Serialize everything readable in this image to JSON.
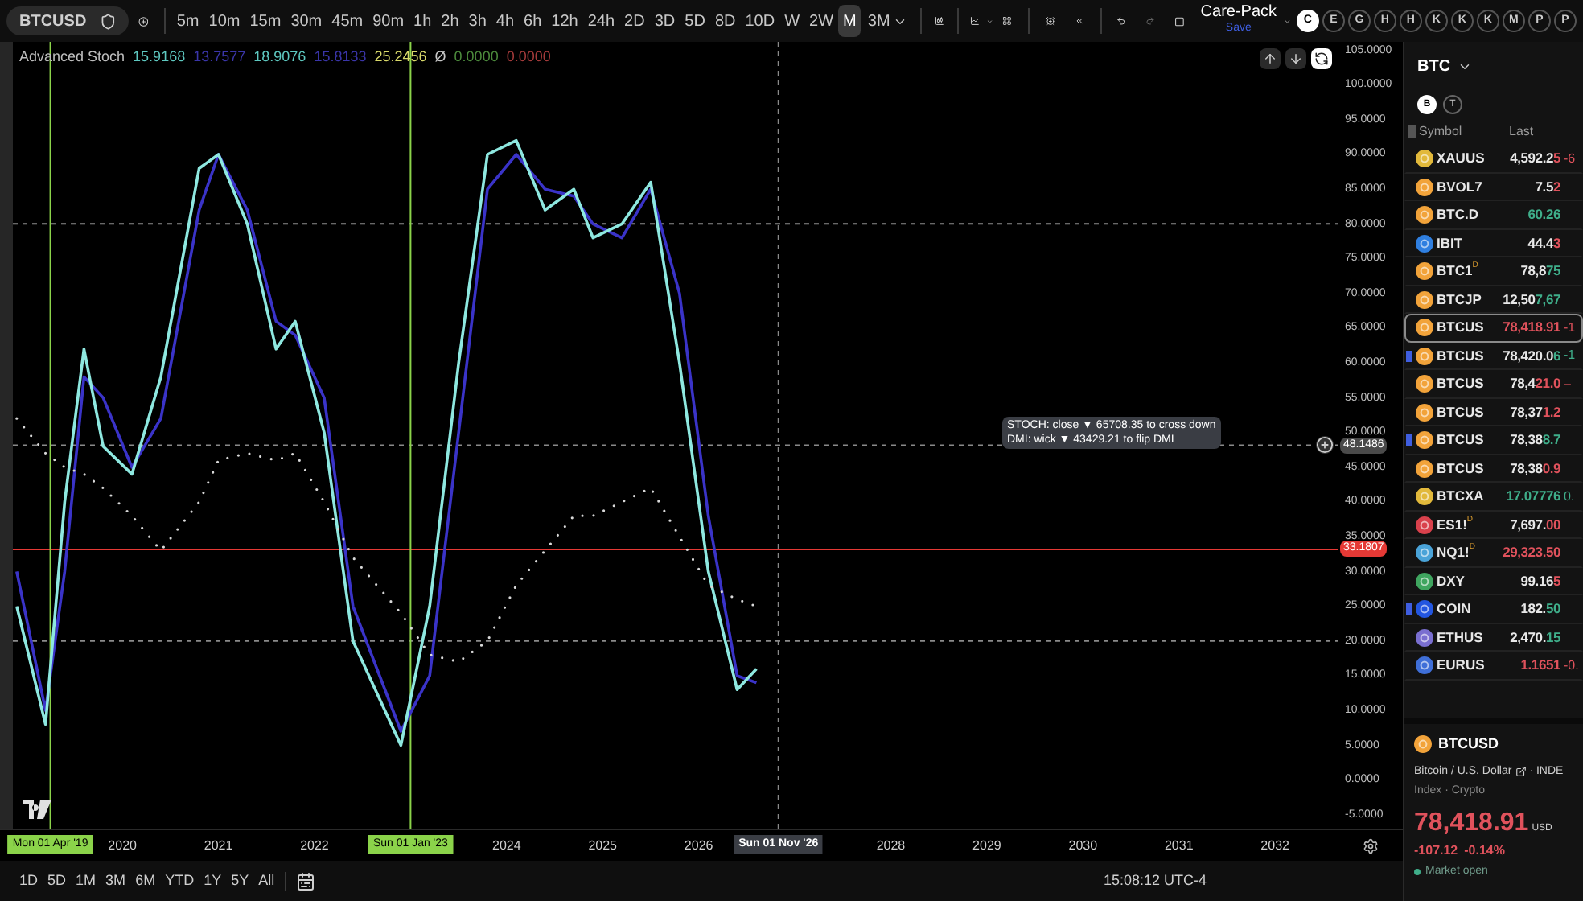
{
  "toolbar": {
    "symbol": "BTCUSD",
    "timeframes": [
      {
        "label": "5m",
        "selected": false
      },
      {
        "label": "10m",
        "selected": false
      },
      {
        "label": "15m",
        "selected": false
      },
      {
        "label": "30m",
        "selected": false
      },
      {
        "label": "45m",
        "selected": false
      },
      {
        "label": "90m",
        "selected": false
      },
      {
        "label": "1h",
        "selected": false
      },
      {
        "label": "2h",
        "selected": false
      },
      {
        "label": "3h",
        "selected": false
      },
      {
        "label": "4h",
        "selected": false
      },
      {
        "label": "6h",
        "selected": false
      },
      {
        "label": "12h",
        "selected": false
      },
      {
        "label": "24h",
        "selected": false
      },
      {
        "label": "2D",
        "selected": false
      },
      {
        "label": "3D",
        "selected": false
      },
      {
        "label": "5D",
        "selected": false
      },
      {
        "label": "8D",
        "selected": false
      },
      {
        "label": "10D",
        "selected": false
      },
      {
        "label": "W",
        "selected": false
      },
      {
        "label": "2W",
        "selected": false
      },
      {
        "label": "M",
        "selected": true
      }
    ],
    "timeframe_menu": "3M",
    "layout": {
      "name": "Care-Pack",
      "status": "Save"
    },
    "quick_buttons": [
      {
        "label": "C",
        "selected": true
      },
      {
        "label": "E",
        "selected": false
      },
      {
        "label": "G",
        "selected": false
      },
      {
        "label": "H",
        "selected": false
      },
      {
        "label": "H",
        "selected": false
      },
      {
        "label": "K",
        "selected": false
      },
      {
        "label": "K",
        "selected": false
      },
      {
        "label": "K",
        "selected": false
      },
      {
        "label": "M",
        "selected": false
      },
      {
        "label": "P",
        "selected": false
      },
      {
        "label": "P",
        "selected": false
      }
    ]
  },
  "legend": {
    "name": "Advanced Stoch",
    "values": [
      {
        "text": "15.9168",
        "color": "#5ec8c0"
      },
      {
        "text": "13.7577",
        "color": "#3a35a8"
      },
      {
        "text": "18.9076",
        "color": "#5ec8c0"
      },
      {
        "text": "15.8133",
        "color": "#3a35a8"
      },
      {
        "text": "25.2456",
        "color": "#d9d96a"
      },
      {
        "text": "Ø",
        "color": "#c8c8c8"
      },
      {
        "text": "0.0000",
        "color": "#4c8a3c"
      },
      {
        "text": "0.0000",
        "color": "#a33a3a"
      }
    ]
  },
  "tooltip": [
    "STOCH: close ▼ 65708.35 to cross down",
    "DMI: wick ▼ 43429.21 to flip DMI"
  ],
  "chart_data": {
    "type": "line",
    "xlim": [
      2018.86,
      2033.33
    ],
    "ylim": [
      -17.41,
      106.2
    ],
    "x": [
      2018.9,
      2019.2,
      2019.4,
      2019.6,
      2019.8,
      2020.1,
      2020.4,
      2020.8,
      2021.0,
      2021.3,
      2021.6,
      2021.8,
      2022.1,
      2022.4,
      2022.9,
      2023.2,
      2023.5,
      2023.8,
      2024.1,
      2024.4,
      2024.7,
      2024.9,
      2025.2,
      2025.5,
      2025.8,
      2026.1,
      2026.4,
      2026.6
    ],
    "series": [
      {
        "color": "#3a33c8",
        "line_style": "solid",
        "values": [
          30,
          10,
          30,
          58,
          55,
          45,
          52,
          82,
          90,
          82,
          66,
          64,
          55,
          25,
          7,
          15,
          50,
          85,
          90,
          85,
          84,
          80,
          78,
          85,
          70,
          38,
          15,
          14
        ]
      },
      {
        "color": "#8ee8e0",
        "line_style": "solid",
        "values": [
          25,
          8,
          40,
          62,
          48,
          44,
          58,
          88,
          90,
          80,
          62,
          66,
          50,
          20,
          5,
          25,
          60,
          90,
          92,
          82,
          85,
          78,
          80,
          86,
          60,
          30,
          13,
          16
        ]
      },
      {
        "color": "#d8d8d8",
        "line_style": "dotted",
        "values": [
          52,
          47,
          45,
          44,
          42,
          38,
          33,
          40,
          46,
          47,
          46,
          47,
          40,
          32,
          24,
          18,
          17,
          20,
          28,
          33,
          38,
          38,
          40,
          42,
          35,
          28,
          26,
          25
        ]
      }
    ],
    "xticks": [
      2020,
      2021,
      2022,
      2024,
      2025,
      2026,
      2028,
      2029,
      2030,
      2031,
      2032
    ],
    "yticks": [
      {
        "value": 105,
        "label": "105.0000"
      },
      {
        "value": 100,
        "label": "100.0000"
      },
      {
        "value": 95,
        "label": "95.0000"
      },
      {
        "value": 90,
        "label": "90.0000"
      },
      {
        "value": 85,
        "label": "85.0000"
      },
      {
        "value": 80,
        "label": "80.0000"
      },
      {
        "value": 75,
        "label": "75.0000"
      },
      {
        "value": 70,
        "label": "70.0000"
      },
      {
        "value": 65,
        "label": "65.0000"
      },
      {
        "value": 60,
        "label": "60.0000"
      },
      {
        "value": 55,
        "label": "55.0000"
      },
      {
        "value": 50,
        "label": "50.0000"
      },
      {
        "value": 45,
        "label": "45.0000"
      },
      {
        "value": 40,
        "label": "40.0000"
      },
      {
        "value": 35,
        "label": "35.0000"
      },
      {
        "value": 30,
        "label": "30.0000"
      },
      {
        "value": 25,
        "label": "25.0000"
      },
      {
        "value": 20,
        "label": "20.0000"
      },
      {
        "value": 15,
        "label": "15.0000"
      },
      {
        "value": 10,
        "label": "10.0000"
      },
      {
        "value": 5,
        "label": "5.0000"
      },
      {
        "value": 0,
        "label": "0.0000"
      },
      {
        "value": -5,
        "label": "-5.0000"
      }
    ],
    "ref_lines": [
      {
        "axis": "y",
        "value": 80,
        "line_style": "dashed"
      },
      {
        "axis": "y",
        "value": 20,
        "line_style": "dashed"
      },
      {
        "axis": "y",
        "value": 48.1486,
        "line_style": "dashed",
        "label": "48.1486"
      },
      {
        "axis": "y",
        "value": 33.1807,
        "line_style": "solid",
        "color": "#e53935",
        "label": "33.1807"
      },
      {
        "axis": "x",
        "value": 2019.25,
        "line_style": "solid",
        "color": "#8bd34a",
        "label": "Mon 01 Apr '19"
      },
      {
        "axis": "x",
        "value": 2023.0,
        "line_style": "solid",
        "color": "#8bd34a",
        "label": "Sun 01 Jan '23"
      },
      {
        "axis": "x",
        "value": 2026.83,
        "line_style": "dashed",
        "label": "Sun 01 Nov '26"
      }
    ]
  },
  "ranges": [
    {
      "label": "1D"
    },
    {
      "label": "5D"
    },
    {
      "label": "1M"
    },
    {
      "label": "3M"
    },
    {
      "label": "6M"
    },
    {
      "label": "YTD"
    },
    {
      "label": "1Y"
    },
    {
      "label": "5Y"
    },
    {
      "label": "All"
    }
  ],
  "clock": "15:08:12 UTC-4",
  "watchlist": {
    "title": "BTC",
    "tabs": [
      {
        "label": "B",
        "selected": true
      },
      {
        "label": "T",
        "selected": false
      }
    ],
    "columns": [
      "Symbol",
      "Last"
    ],
    "rows": [
      {
        "kind": "gold",
        "symbol": "XAUUS",
        "price": "4,592.2",
        "price_move": "5",
        "color": "#e0525c",
        "change": "-6",
        "flagged": false,
        "selected": false
      },
      {
        "kind": "crypto",
        "symbol": "BVOL7",
        "price": "7.5",
        "price_move": "2",
        "color": "#e0525c",
        "flagged": false,
        "selected": false
      },
      {
        "kind": "crypto",
        "symbol": "BTC.D",
        "price_move": "60.26",
        "color": "#3fae8a",
        "flagged": false,
        "selected": false
      },
      {
        "kind": "fund",
        "symbol": "IBIT",
        "price": "44.4",
        "price_move": "3",
        "color": "#e0525c",
        "flagged": false,
        "selected": false
      },
      {
        "kind": "crypto",
        "symbol": "BTC1",
        "badge": "D",
        "price": "78,8",
        "price_move": "75",
        "color": "#3fae8a",
        "flagged": false,
        "selected": false
      },
      {
        "kind": "crypto",
        "symbol": "BTCJP",
        "price": "12,50",
        "price_move": "7,67",
        "color": "#3fae8a",
        "flagged": false,
        "selected": false
      },
      {
        "kind": "crypto",
        "symbol": "BTCUS",
        "price_move": "78,418.91",
        "color": "#e0525c",
        "change": "-1",
        "flagged": false,
        "selected": true
      },
      {
        "kind": "crypto",
        "symbol": "BTCUS",
        "price": "78,420.0",
        "price_move": "6",
        "color": "#3fae8a",
        "change": "-1",
        "flagged": true,
        "selected": false
      },
      {
        "kind": "crypto",
        "symbol": "BTCUS",
        "price": "78,4",
        "price_move": "21.0",
        "color": "#e0525c",
        "change": "–",
        "flagged": false,
        "selected": false
      },
      {
        "kind": "crypto",
        "symbol": "BTCUS",
        "price": "78,37",
        "price_move": "1.2",
        "color": "#e0525c",
        "flagged": false,
        "selected": false
      },
      {
        "kind": "crypto",
        "symbol": "BTCUS",
        "price": "78,38",
        "price_move": "8.7",
        "color": "#3fae8a",
        "flagged": true,
        "selected": false
      },
      {
        "kind": "crypto",
        "symbol": "BTCUS",
        "price": "78,38",
        "price_move": "0.9",
        "color": "#e0525c",
        "flagged": false,
        "selected": false
      },
      {
        "kind": "gold",
        "symbol": "BTCXA",
        "price_move": "17.07776",
        "color": "#3fae8a",
        "change": "0.",
        "flagged": false,
        "selected": false
      },
      {
        "kind": "futures-es",
        "symbol": "ES1!",
        "badge": "D",
        "price": "7,697.",
        "price_move": "00",
        "color": "#e0525c",
        "flagged": false,
        "selected": false
      },
      {
        "kind": "futures-nq",
        "symbol": "NQ1!",
        "badge": "D",
        "price_move": "29,323.50",
        "color": "#e0525c",
        "flagged": false,
        "selected": false
      },
      {
        "kind": "dollar",
        "symbol": "DXY",
        "price": "99.16",
        "price_move": "5",
        "color": "#e0525c",
        "flagged": false,
        "selected": false
      },
      {
        "kind": "stock",
        "symbol": "COIN",
        "price": "182.",
        "price_move": "50",
        "color": "#3fae8a",
        "flagged": true,
        "selected": false
      },
      {
        "kind": "eth",
        "symbol": "ETHUS",
        "price": "2,470.",
        "price_move": "15",
        "color": "#3fae8a",
        "flagged": false,
        "selected": false
      },
      {
        "kind": "forex",
        "symbol": "EURUS",
        "price_move": "1.1651",
        "color": "#e0525c",
        "change": "-0.",
        "flagged": false,
        "selected": false
      }
    ]
  },
  "details": {
    "symbol": "BTCUSD",
    "description": "Bitcoin / U.S. Dollar",
    "exchange": "· INDE",
    "category": "Index · Crypto",
    "price": "78,418.91",
    "currency": "USD",
    "change": "-107.12",
    "change_percent": "-0.14%",
    "color": "#e0525c",
    "status": "Market open"
  }
}
